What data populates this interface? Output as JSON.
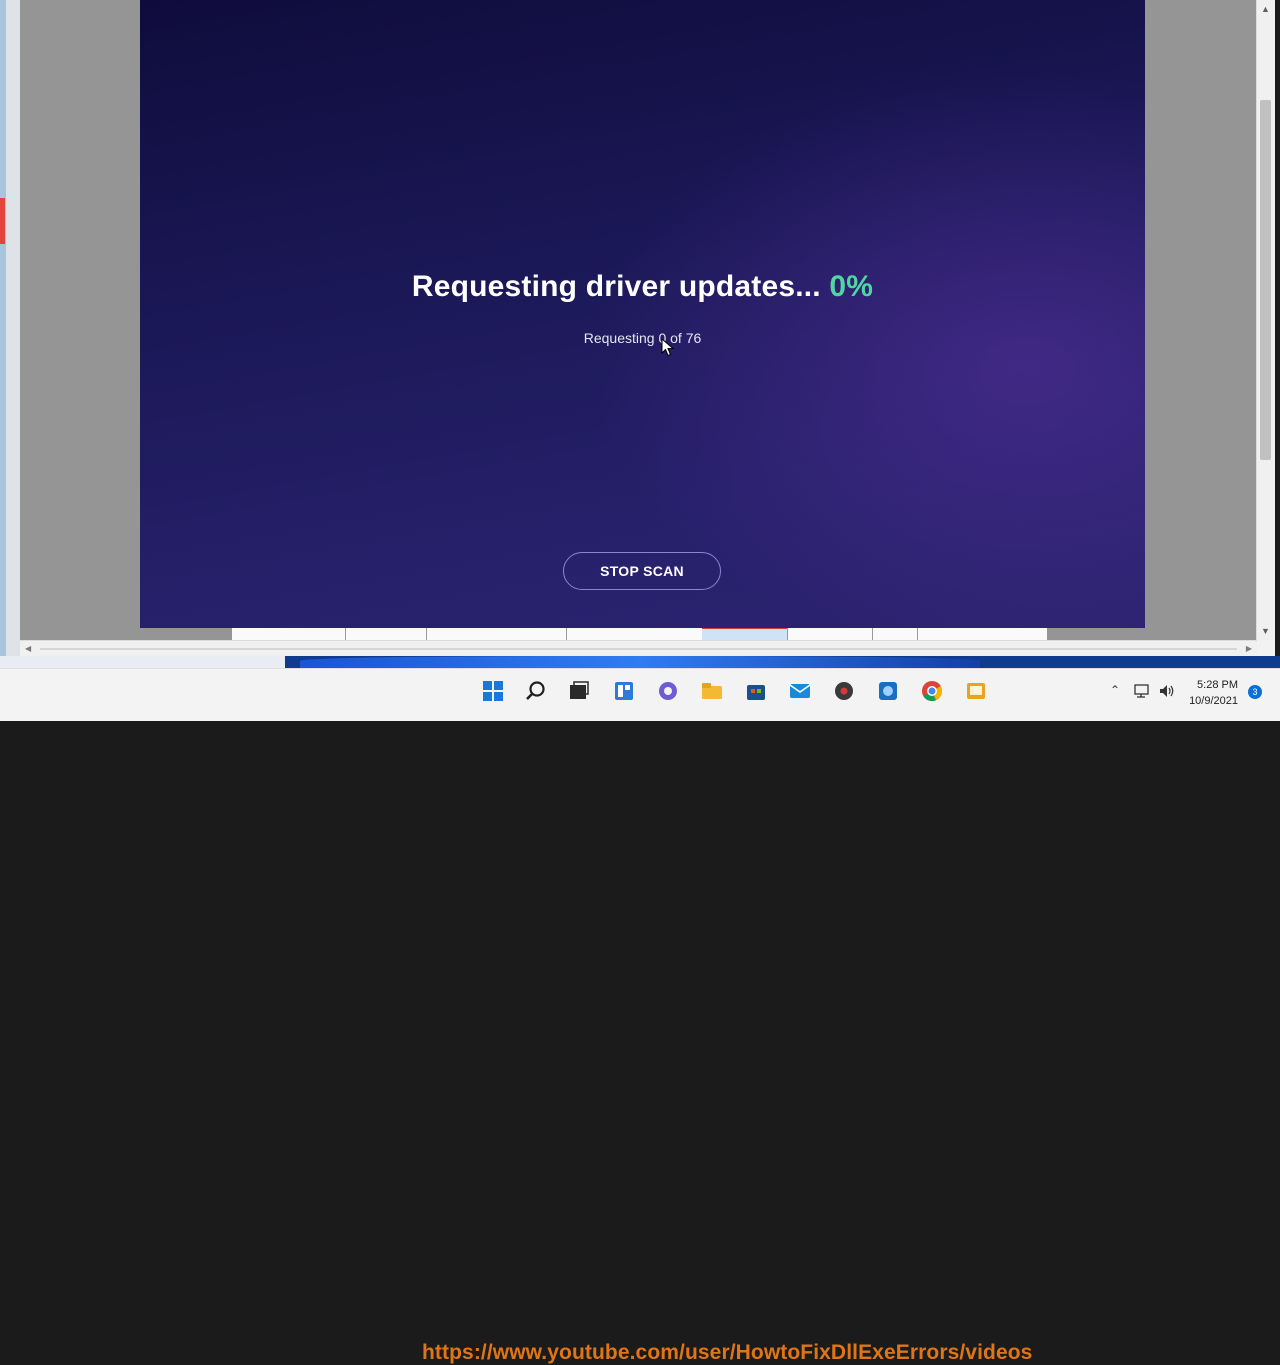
{
  "scan": {
    "heading": "Requesting driver updates...",
    "percent": "0%",
    "progress_fraction": 0,
    "subtext": "Requesting 0 of 76",
    "stop_button": "STOP SCAN",
    "accent_color": "#4fd6a3"
  },
  "overlay": {
    "url": "https://www.youtube.com/user/HowtoFixDllExeErrors/videos"
  },
  "taskbar": {
    "icons": [
      "windows-start-icon",
      "search-icon",
      "task-view-icon",
      "widgets-icon",
      "teams-chat-icon",
      "file-explorer-icon",
      "store-icon",
      "mail-icon",
      "media-icon",
      "chrome-icon",
      "app-icon"
    ],
    "time": "5:28 PM",
    "date": "10/9/2021",
    "notification_count": "3"
  }
}
